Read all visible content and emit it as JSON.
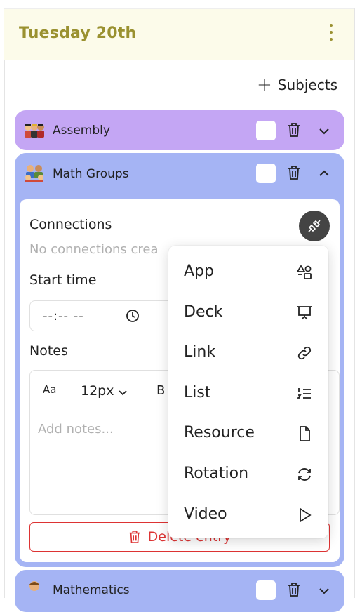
{
  "header": {
    "title": "Tuesday 20th"
  },
  "toolbar": {
    "subjects_label": "Subjects",
    "subjects_icon": "plus-icon"
  },
  "cards": {
    "assembly": {
      "title": "Assembly",
      "color": "#c4a6f4",
      "emoji": "students-emoji"
    },
    "math_groups": {
      "title": "Math Groups",
      "color": "#a5b4f4",
      "emoji": "group-emoji"
    },
    "mathematics": {
      "title": "Mathematics",
      "color": "#a5b4f4",
      "emoji": "teacher-emoji"
    }
  },
  "entry": {
    "connections_label": "Connections",
    "connections_empty": "No connections crea",
    "start_time_label": "Start time",
    "start_time_value": "--:-- --",
    "notes_label": "Notes",
    "font_icon_text": "Aa",
    "font_size": "12px",
    "bold_label": "B",
    "notes_placeholder": "Add notes...",
    "delete_label": "Delete entry"
  },
  "menu": {
    "items": [
      {
        "label": "App",
        "icon": "shapes-icon"
      },
      {
        "label": "Deck",
        "icon": "presentation-icon"
      },
      {
        "label": "Link",
        "icon": "link-icon"
      },
      {
        "label": "List",
        "icon": "numbered-list-icon"
      },
      {
        "label": "Resource",
        "icon": "file-icon"
      },
      {
        "label": "Rotation",
        "icon": "rotate-icon"
      },
      {
        "label": "Video",
        "icon": "play-icon"
      }
    ]
  },
  "colors": {
    "accent": "#9a9130",
    "danger": "#d33333",
    "header_bg": "#fcfbea"
  }
}
